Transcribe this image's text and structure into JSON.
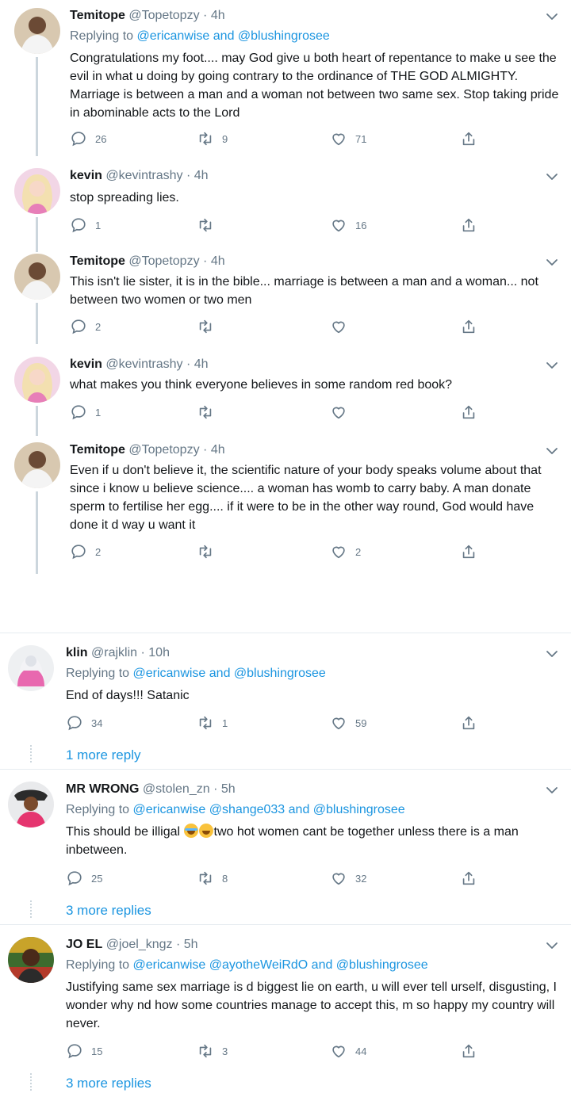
{
  "tweets": [
    {
      "name": "Temitope",
      "handle": "@Topetopzy",
      "time": "4h",
      "replying_prefix": "Replying to ",
      "replying_mentions": "@ericanwise and @blushingrosee",
      "text": "Congratulations my foot.... may God give u both heart of repentance  to make u see the evil in what u doing by going contrary to the ordinance of THE GOD ALMIGHTY. Marriage is between a man and a woman not between two same sex. Stop taking pride in abominable acts to the Lord",
      "replies": "26",
      "retweets": "9",
      "likes": "71"
    },
    {
      "name": "kevin",
      "handle": "@kevintrashy",
      "time": "4h",
      "text": "stop spreading lies.",
      "replies": "1",
      "retweets": "",
      "likes": "16"
    },
    {
      "name": "Temitope",
      "handle": "@Topetopzy",
      "time": "4h",
      "text": "This isn't lie sister,  it is in the bible... marriage is between a man and a woman... not between two women or two men",
      "replies": "2",
      "retweets": "",
      "likes": ""
    },
    {
      "name": "kevin",
      "handle": "@kevintrashy",
      "time": "4h",
      "text": "what makes you think everyone believes in some random red book?",
      "replies": "1",
      "retweets": "",
      "likes": ""
    },
    {
      "name": "Temitope",
      "handle": "@Topetopzy",
      "time": "4h",
      "text": "Even if u don't believe it, the scientific nature of your body speaks volume about that since i know u believe science....  a woman has womb to carry baby. A man donate sperm to fertilise her egg.... if it were to be in the other way round, God would have done it d way u want it",
      "replies": "2",
      "retweets": "",
      "likes": "2"
    },
    {
      "name": "klin",
      "handle": "@rajklin",
      "time": "10h",
      "replying_prefix": "Replying to ",
      "replying_mentions": "@ericanwise and @blushingrosee",
      "text": "End of days!!! Satanic",
      "replies": "34",
      "retweets": "1",
      "likes": "59",
      "more": "1 more reply"
    },
    {
      "name": "MR WRONG",
      "handle": "@stolen_zn",
      "time": "5h",
      "replying_prefix": "Replying to ",
      "replying_mentions": "@ericanwise @shange033 and @blushingrosee",
      "text_before": "This should be illigal ",
      "text_after": "two hot women cant be together unless there is a man inbetween.",
      "replies": "25",
      "retweets": "8",
      "likes": "32",
      "more": "3 more replies"
    },
    {
      "name": "JO EL",
      "handle": "@joel_kngz",
      "time": "5h",
      "replying_prefix": "Replying to ",
      "replying_mentions": "@ericanwise @ayotheWeiRdO and @blushingrosee",
      "text": "Justifying same sex marriage is d biggest lie on earth, u will ever tell urself, disgusting, I wonder why nd how some countries manage to accept this, m so happy my country will never.",
      "replies": "15",
      "retweets": "3",
      "likes": "44",
      "more": "3 more replies"
    }
  ],
  "dot": "·",
  "colors": {
    "link": "#1b95e0",
    "muted": "#657786",
    "text": "#14171a",
    "divider": "#e6ecf0"
  },
  "icons": [
    "reply-icon",
    "retweet-icon",
    "like-icon",
    "share-icon",
    "chevron-down-icon",
    "face-with-tears-of-joy-emoji",
    "grinning-face-emoji"
  ]
}
